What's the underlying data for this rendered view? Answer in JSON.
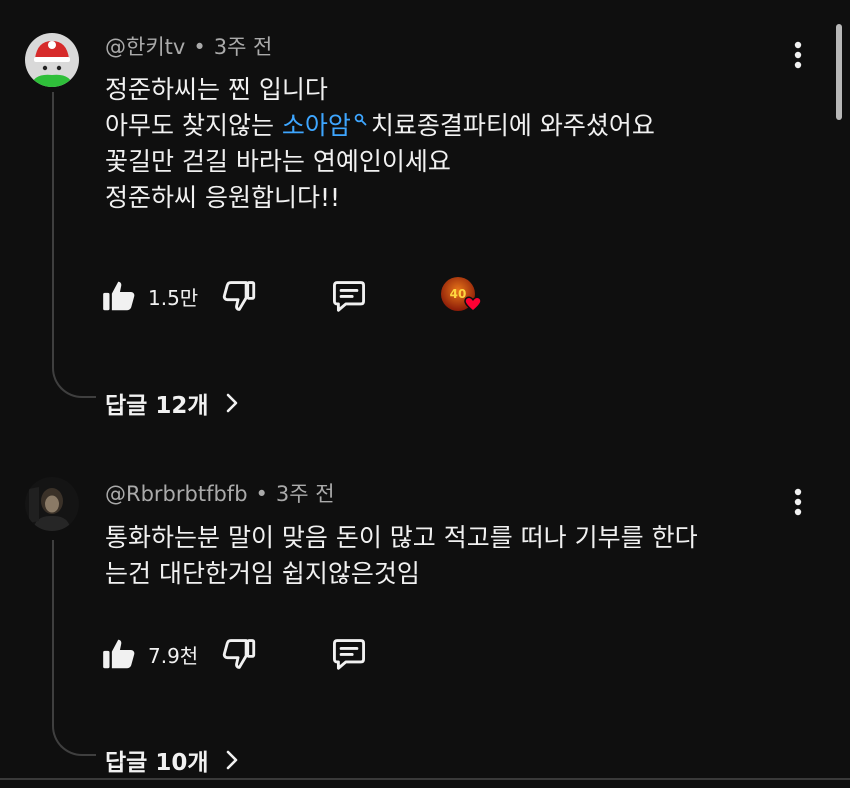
{
  "comments": [
    {
      "author": "@한키tv",
      "time": "3주 전",
      "text": {
        "line1": "정준하씨는 찐 입니다",
        "line2_before": "아무도 찾지않는 ",
        "line2_link": "소아암",
        "line2_after": "치료종결파티에 와주셨어요",
        "line3": "꽃길만 걷길 바라는 연예인이세요",
        "line4": "정준하씨 응원합니다!!"
      },
      "likes": "1.5만",
      "replies_label": "답글 12개"
    },
    {
      "author": "@Rbrbrbtfbfb",
      "time": "3주 전",
      "text": {
        "line1": "통화하는분 말이 맞음 돈이 많고 적고를 떠나 기부를 한다",
        "line2": "는건 대단한거임 쉽지않은것임"
      },
      "likes": "7.9천",
      "replies_label": "답글 10개"
    }
  ],
  "meta_separator": "•",
  "creator_heart_badge": "40",
  "icons": {
    "like": "thumbs-up-icon",
    "dislike": "thumbs-down-icon",
    "reply": "comment-icon",
    "more": "kebab-menu-icon",
    "chevron": "chevron-right-icon",
    "search": "search-icon",
    "heart": "heart-icon"
  },
  "colors": {
    "background": "#0f0f0f",
    "text": "#f1f1f1",
    "meta": "#aaaaaa",
    "link": "#3ea6ff",
    "heart": "#ff0033"
  }
}
